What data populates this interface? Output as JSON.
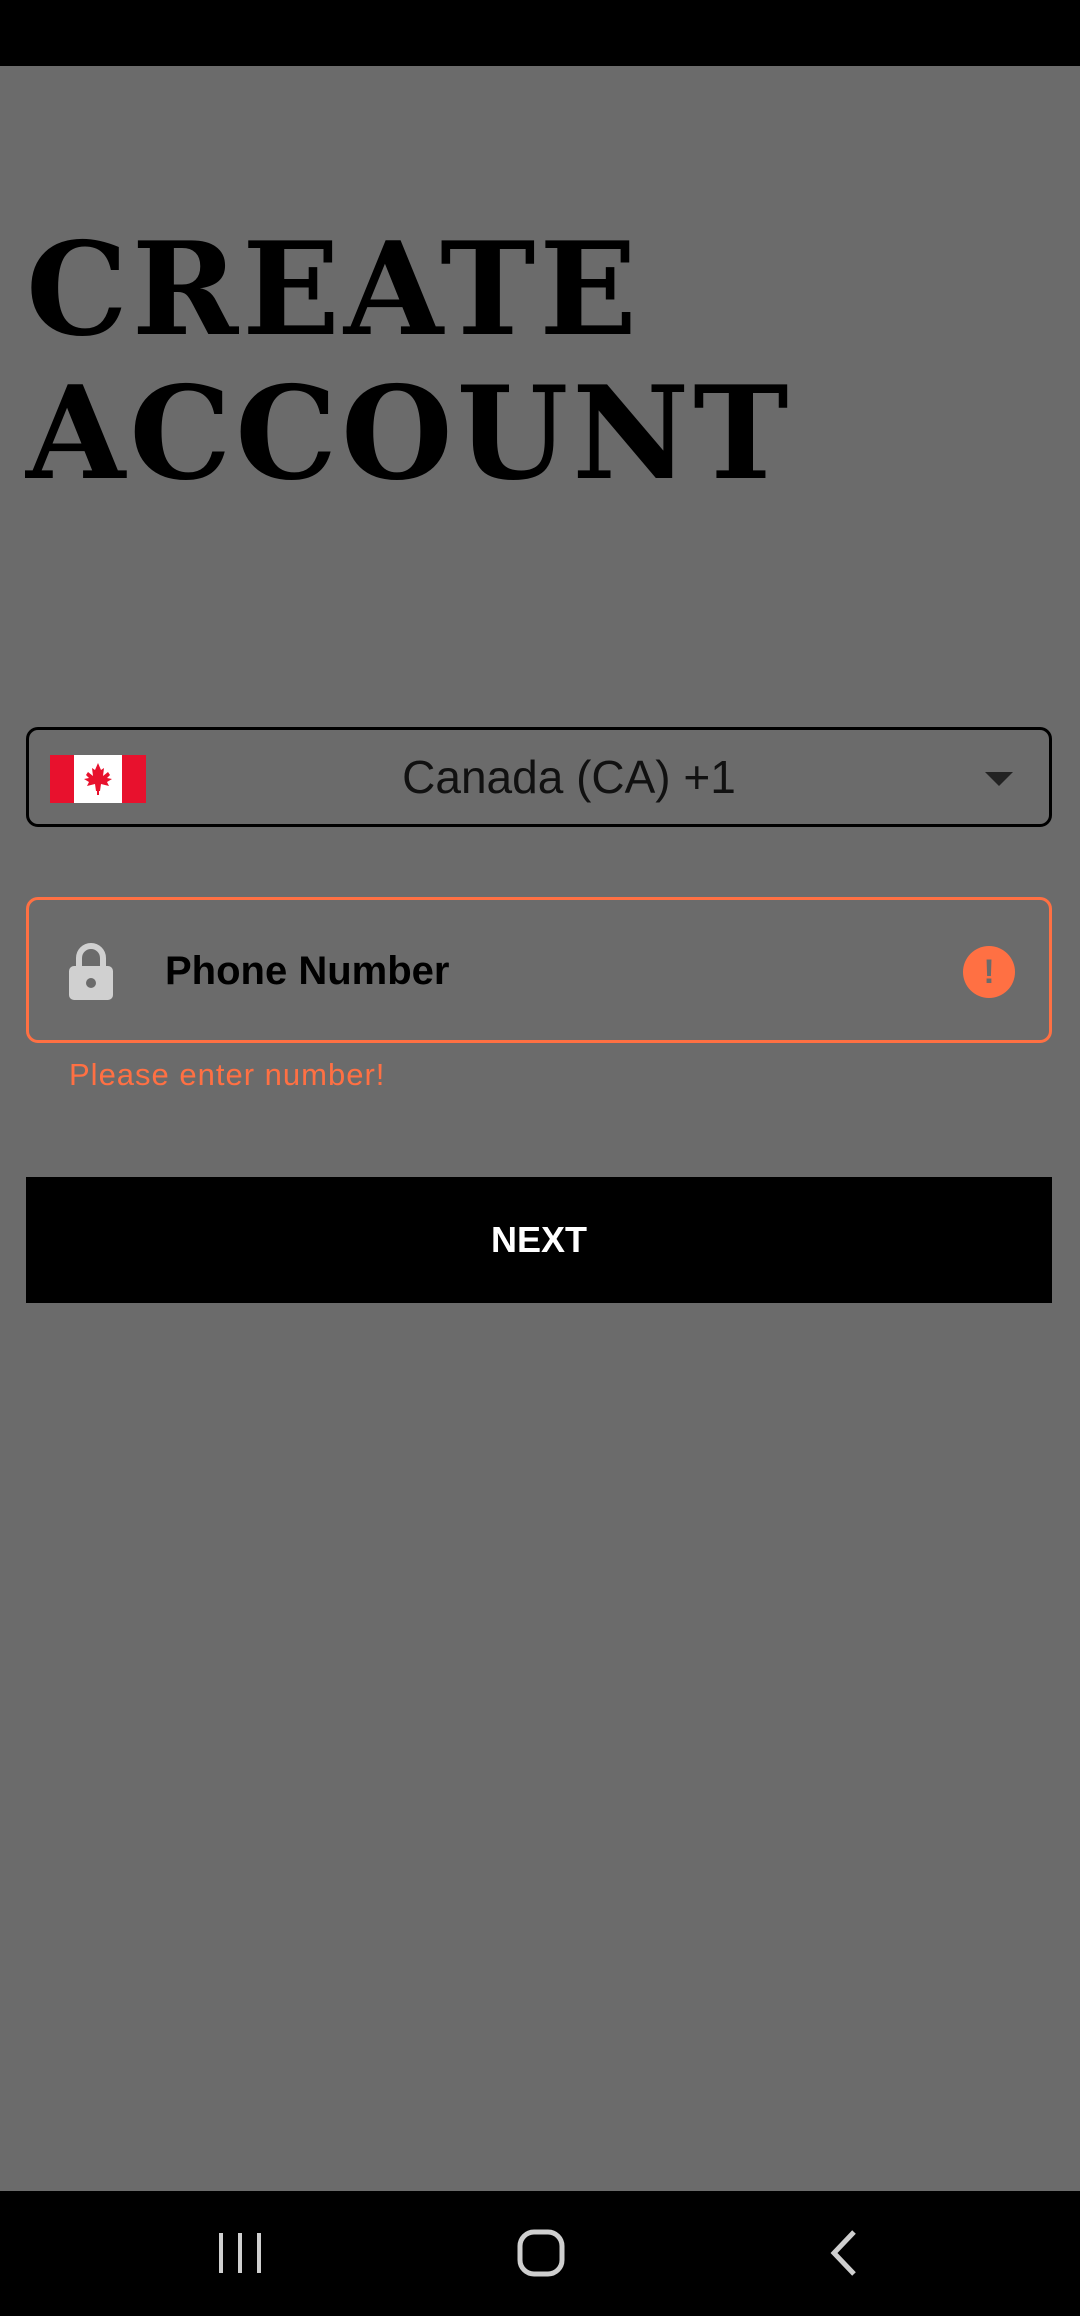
{
  "title": "CREATE ACCOUNT",
  "country_selector": {
    "flag_icon": "canada-flag-icon",
    "value": "Canada (CA)  +1"
  },
  "phone_field": {
    "placeholder": "Phone Number",
    "value": "",
    "error": "Please enter number!"
  },
  "next_button": {
    "label": "NEXT"
  },
  "nav_bar": {
    "recents_icon": "recents-icon",
    "home_icon": "home-icon",
    "back_icon": "back-icon"
  },
  "colors": {
    "background": "#6b6b6b",
    "error": "#ff7043",
    "button": "#000000"
  }
}
